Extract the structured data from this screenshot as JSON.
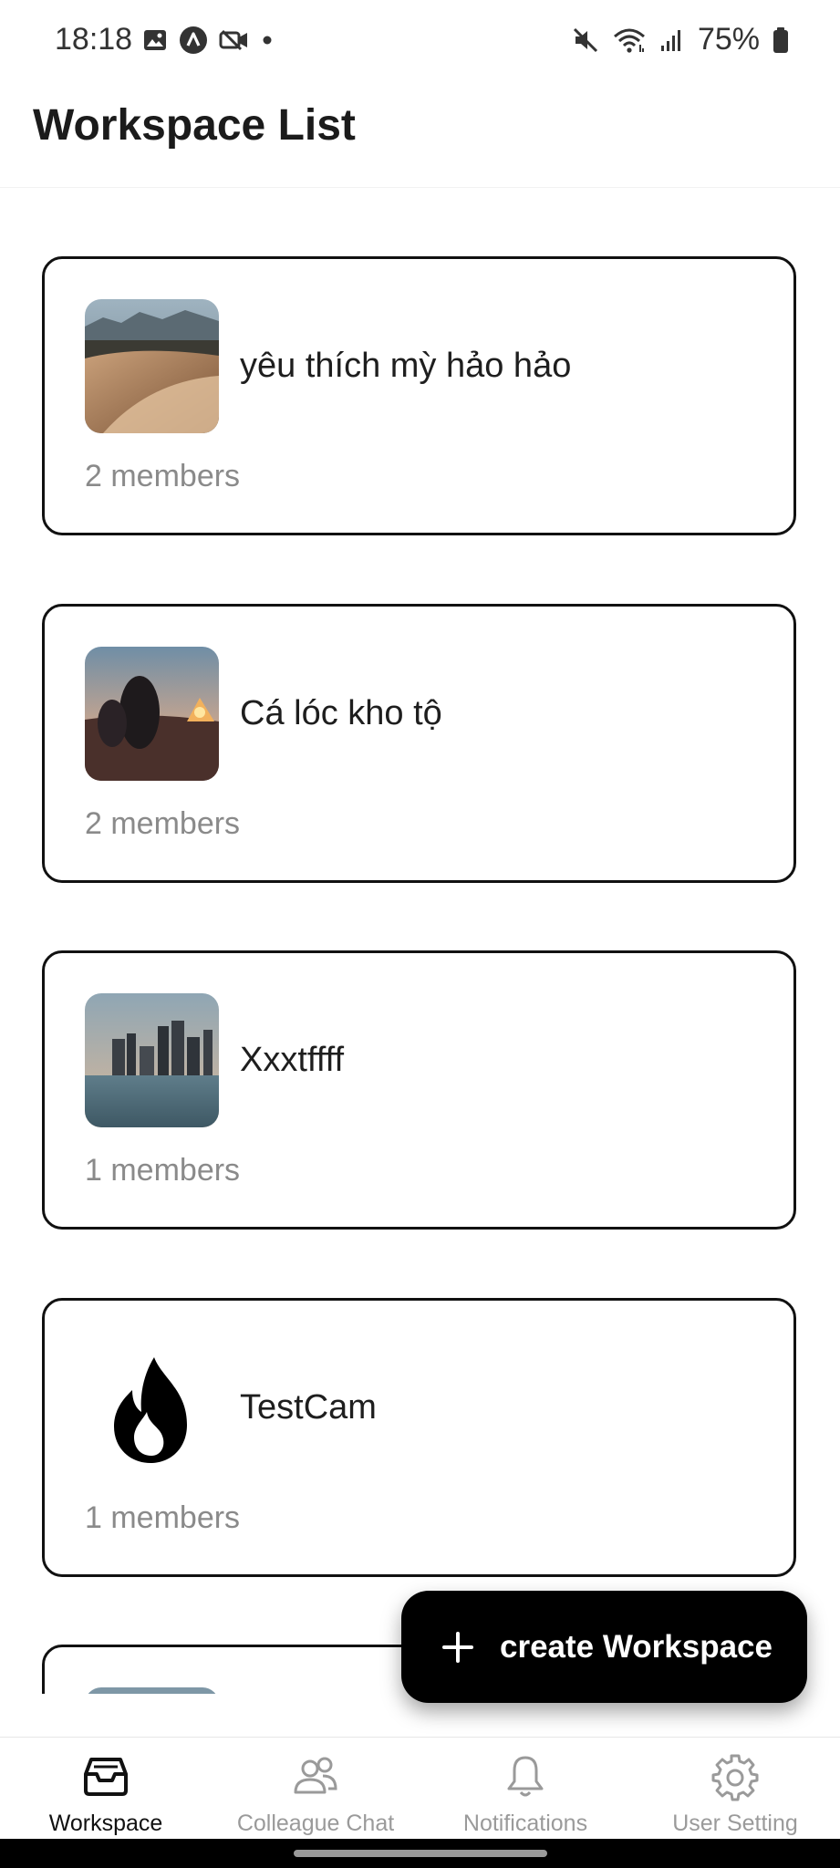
{
  "status_bar": {
    "time": "18:18",
    "left_icons": [
      "image-icon",
      "app-a-icon",
      "video-off-icon",
      "dot-icon"
    ],
    "right_icons": [
      "mute-icon",
      "wifi-icon",
      "signal-icon",
      "battery-icon"
    ],
    "battery_percent": "75%"
  },
  "header": {
    "title": "Workspace List"
  },
  "workspaces": [
    {
      "name": "yêu thích mỳ hảo hảo",
      "members": "2 members",
      "thumbnail": "desert-dunes-photo"
    },
    {
      "name": "Cá lóc kho tộ",
      "members": "2 members",
      "thumbnail": "camping-dusk-photo"
    },
    {
      "name": "Xxxtffff",
      "members": "1 members",
      "thumbnail": "city-skyline-photo"
    },
    {
      "name": "TestCam",
      "members": "1 members",
      "thumbnail": "flame-icon"
    },
    {
      "name": "",
      "members": "",
      "thumbnail": "partial-photo"
    }
  ],
  "fab": {
    "label": "create Workspace",
    "icon": "plus-icon"
  },
  "bottom_nav": {
    "items": [
      {
        "label": "Workspace",
        "icon": "inbox-tray-icon",
        "active": true
      },
      {
        "label": "Colleague Chat",
        "icon": "people-icon",
        "active": false
      },
      {
        "label": "Notifications",
        "icon": "bell-icon",
        "active": false
      },
      {
        "label": "User Setting",
        "icon": "gear-icon",
        "active": false
      }
    ]
  },
  "colors": {
    "card_border": "#111111",
    "fab_bg": "#000000",
    "muted_text": "#8a8a8a",
    "nav_inactive": "#9a9a9a"
  }
}
